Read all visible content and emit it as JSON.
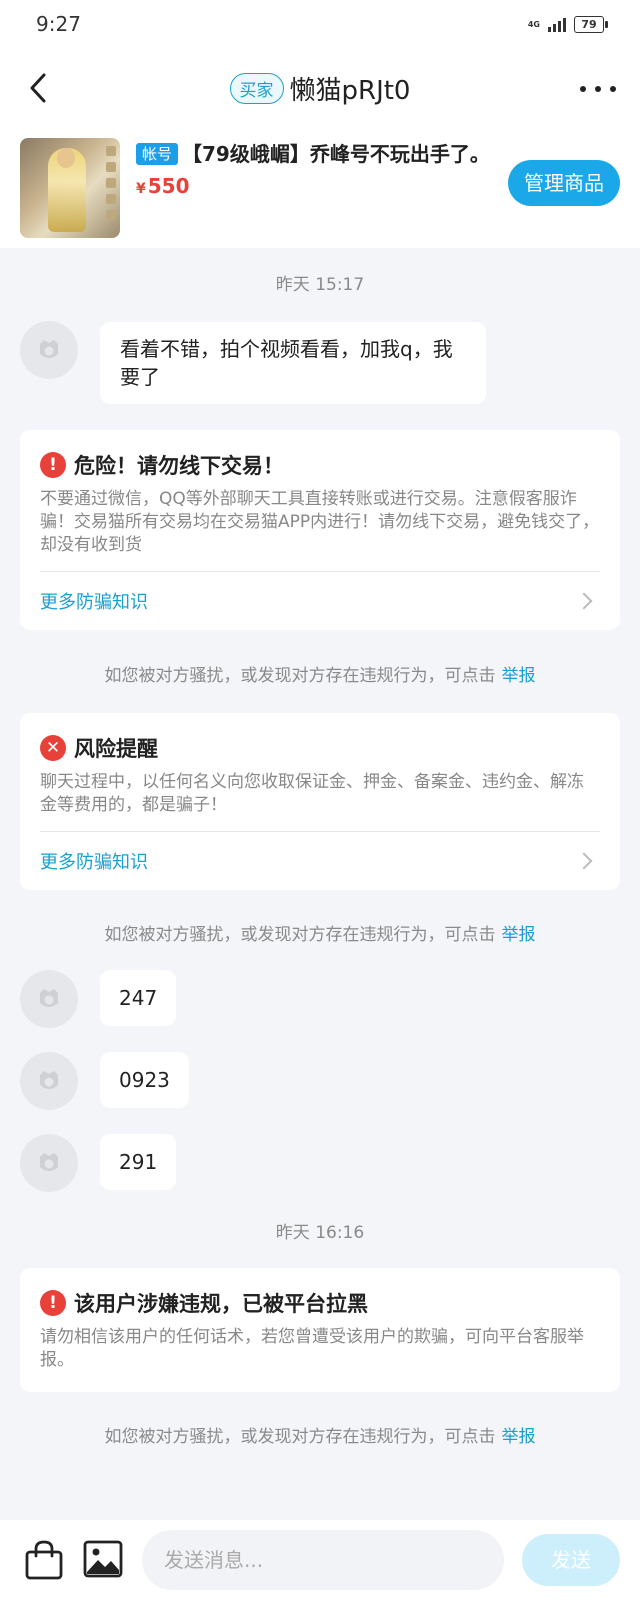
{
  "status_bar": {
    "time": "9:27",
    "network": "4G",
    "battery": "79"
  },
  "nav": {
    "role_badge": "买家",
    "title": "懒猫pRJt0"
  },
  "product": {
    "tag": "帐号",
    "title": "【79级峨嵋】乔峰号不玩出手了。",
    "currency": "¥",
    "price": "550",
    "manage_button": "管理商品"
  },
  "messages": {
    "time1": "昨天  15:17",
    "msg1": "看着不错，拍个视频看看，加我q，我要了",
    "msg2": "247",
    "msg3": "0923",
    "msg4": "291",
    "time2": "昨天  16:16"
  },
  "alerts": {
    "danger": {
      "title": "危险！请勿线下交易！",
      "body": "不要通过微信，QQ等外部聊天工具直接转账或进行交易。注意假客服诈骗！交易猫所有交易均在交易猫APP内进行！请勿线下交易，避免钱交了，却没有收到货",
      "link": "更多防骗知识"
    },
    "risk": {
      "title": "风险提醒",
      "body": "聊天过程中，以任何名义向您收取保证金、押金、备案金、违约金、解冻金等费用的，都是骗子！",
      "link": "更多防骗知识"
    },
    "blocked": {
      "title": "该用户涉嫌违规，已被平台拉黑",
      "body": "请勿相信该用户的任何话术，若您曾遭受该用户的欺骗，可向平台客服举报。"
    }
  },
  "report": {
    "text": "如您被对方骚扰，或发现对方存在违规行为，可点击",
    "link": "举报"
  },
  "input": {
    "placeholder": "发送消息...",
    "send_label": "发送"
  },
  "icons": {
    "back": "chevron-left-icon",
    "more": "more-icon",
    "bag": "shopping-bag-icon",
    "image": "image-icon",
    "avatar": "default-avatar-icon"
  },
  "colors": {
    "accent": "#1aa8e8",
    "price": "#e8413a",
    "danger": "#e8413a",
    "link": "#1a9fd0"
  }
}
